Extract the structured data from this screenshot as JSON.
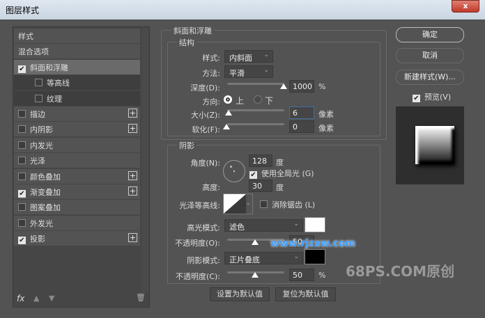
{
  "window": {
    "title": "图层样式",
    "close": "x"
  },
  "left": {
    "items": [
      {
        "label": "样式"
      },
      {
        "label": "混合选项"
      },
      {
        "label": "斜面和浮雕",
        "checked": true
      },
      {
        "label": "等高线",
        "checked": false
      },
      {
        "label": "纹理",
        "checked": false
      },
      {
        "label": "描边",
        "checked": false,
        "plus": "+"
      },
      {
        "label": "内阴影",
        "checked": false,
        "plus": "+"
      },
      {
        "label": "内发光",
        "checked": false
      },
      {
        "label": "光泽",
        "checked": false
      },
      {
        "label": "颜色叠加",
        "checked": false,
        "plus": "+"
      },
      {
        "label": "渐变叠加",
        "checked": true,
        "plus": "+"
      },
      {
        "label": "图案叠加",
        "checked": false
      },
      {
        "label": "外发光",
        "checked": false
      },
      {
        "label": "投影",
        "checked": true,
        "plus": "+"
      }
    ],
    "fx": "fx"
  },
  "bevel": {
    "title": "斜面和浮雕",
    "structure": "结构",
    "style_label": "样式:",
    "style_value": "内斜面",
    "technique_label": "方法:",
    "technique_value": "平滑",
    "depth_label": "深度(D):",
    "depth_value": "1000",
    "depth_unit": "%",
    "direction_label": "方向:",
    "up": "上",
    "down": "下",
    "size_label": "大小(Z):",
    "size_value": "6",
    "size_unit": "像素",
    "soften_label": "软化(F):",
    "soften_value": "0",
    "soften_unit": "像素"
  },
  "shading": {
    "title": "阴影",
    "angle_label": "角度(N):",
    "angle_value": "128",
    "deg": "度",
    "global_light": "使用全局光 (G)",
    "altitude_label": "高度:",
    "altitude_value": "30",
    "gloss_label": "光泽等高线:",
    "antialias": "消除锯齿 (L)",
    "highlight_label": "高光模式:",
    "highlight_mode": "滤色",
    "highlight_opacity_label": "不透明度(O):",
    "highlight_opacity": "50",
    "shadow_label": "阴影模式:",
    "shadow_mode": "正片叠底",
    "shadow_opacity_label": "不透明度(C):",
    "shadow_opacity": "50",
    "pct": "%",
    "highlight_color": "#ffffff",
    "shadow_color": "#000000"
  },
  "footer": {
    "make_default": "设置为默认值",
    "reset_default": "复位为默认值"
  },
  "right": {
    "ok": "确定",
    "cancel": "取消",
    "new_style": "新建样式(W)...",
    "preview": "预览(V)"
  },
  "watermarks": {
    "site": "www.rjzxw.com",
    "brand": "68PS.COM原创"
  }
}
